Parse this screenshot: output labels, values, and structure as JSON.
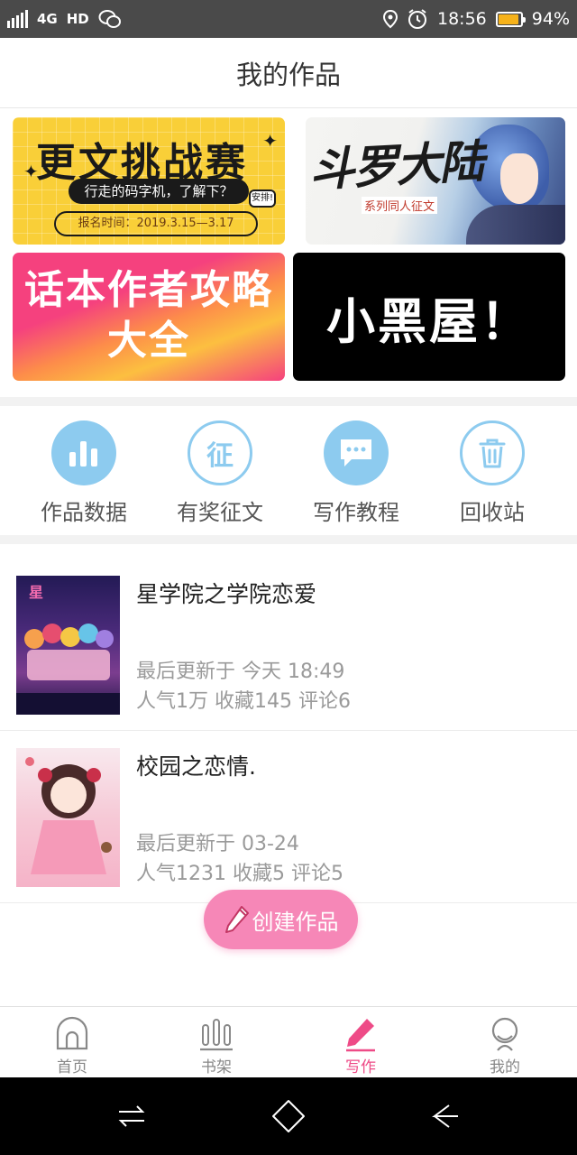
{
  "status_bar": {
    "network": "4G",
    "hd": "HD",
    "time": "18:56",
    "battery_percent_label": "94%",
    "battery_level": 0.94
  },
  "header": {
    "title": "我的作品"
  },
  "banners": {
    "challenge": {
      "title": "更文挑战赛",
      "subtitle": "行走的码字机，了解下？",
      "date": "报名时间：2019.3.15—3.17",
      "tag": "安排!"
    },
    "douluo": {
      "title": "斗罗大陆",
      "subtitle": "系列同人征文"
    },
    "guide": {
      "line1": "话本作者攻略",
      "line2": "大全"
    },
    "blackroom": {
      "text": "小黑屋！"
    }
  },
  "quick_actions": [
    {
      "label": "作品数据",
      "icon": "bar-chart-icon"
    },
    {
      "label": "有奖征文",
      "icon": "contest-icon",
      "glyph": "征"
    },
    {
      "label": "写作教程",
      "icon": "chat-bubble-icon"
    },
    {
      "label": "回收站",
      "icon": "trash-icon"
    }
  ],
  "works": [
    {
      "title": "星学院之学院恋爱",
      "updated": "最后更新于 今天 18:49",
      "stats": "人气1万 收藏145 评论6"
    },
    {
      "title": "校园之恋情.",
      "updated": "最后更新于 03-24",
      "stats": "人气1231 收藏5 评论5"
    }
  ],
  "create_button": {
    "label": "创建作品"
  },
  "tabbar": {
    "home": "首页",
    "shelf": "书架",
    "write": "写作",
    "mine": "我的",
    "active_color": "#ee4b87"
  },
  "colors": {
    "accent": "#f687b7",
    "icon_blue": "#8dcbef"
  }
}
